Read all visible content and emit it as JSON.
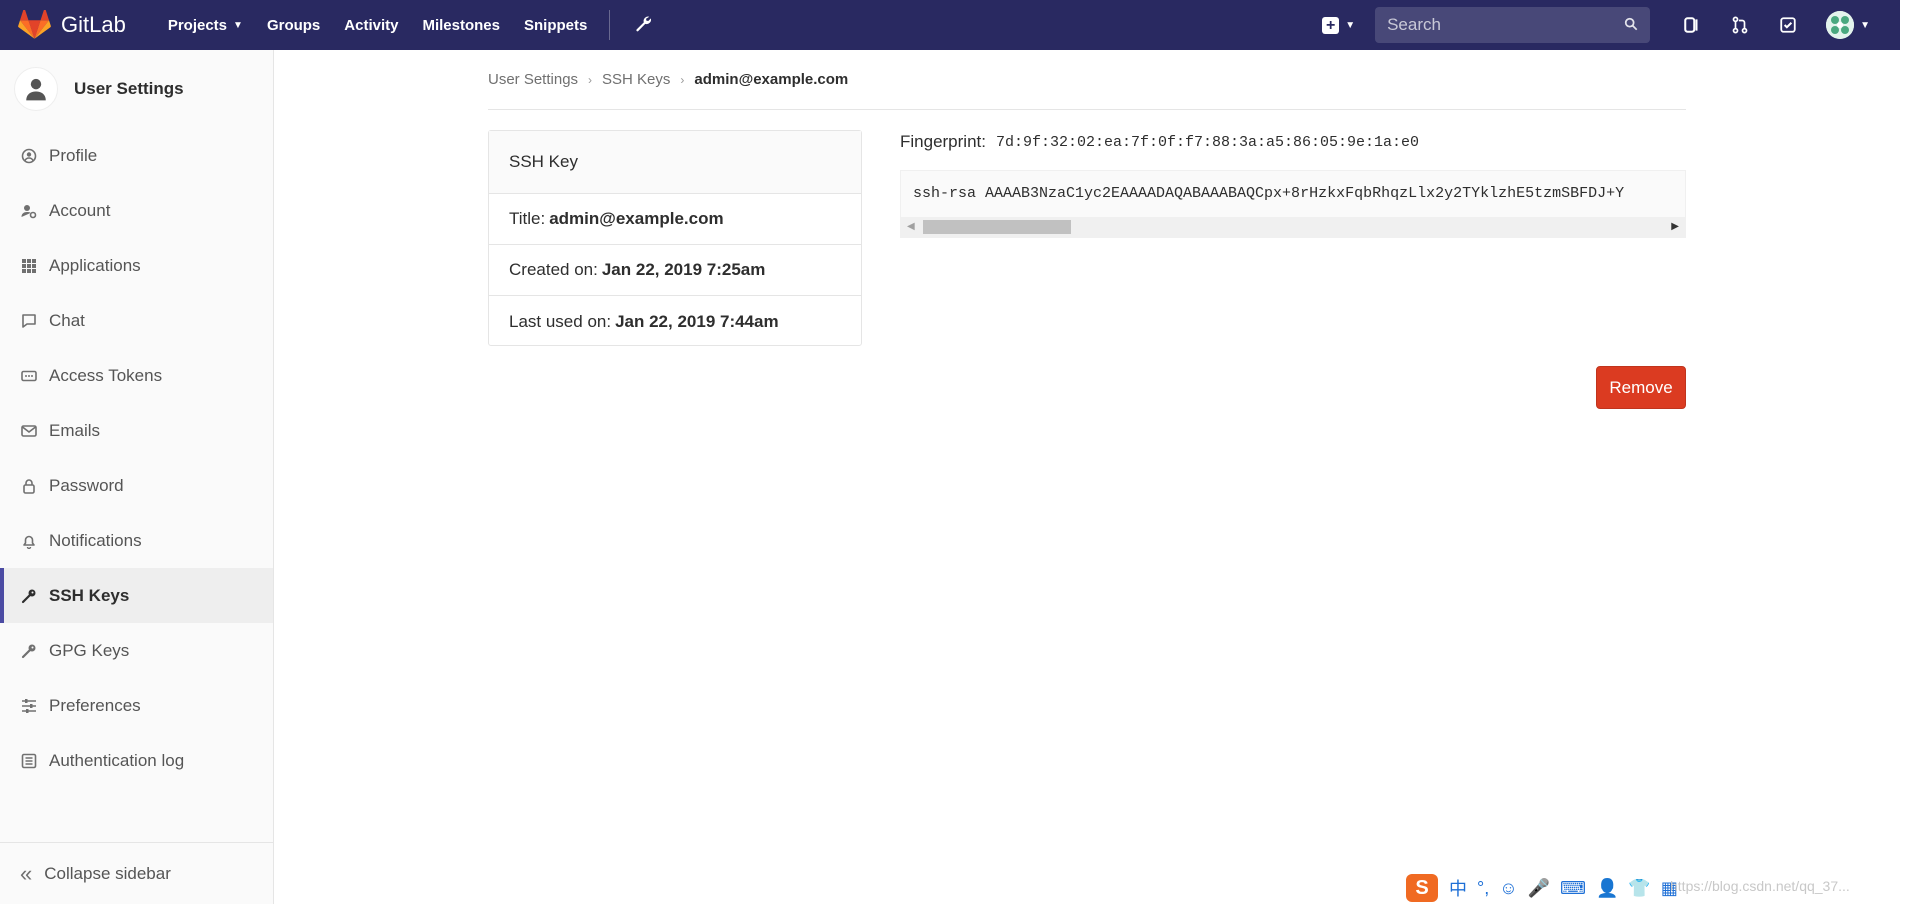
{
  "nav": {
    "brand": "GitLab",
    "links": [
      "Projects",
      "Groups",
      "Activity",
      "Milestones",
      "Snippets"
    ],
    "search_placeholder": "Search"
  },
  "sidebar": {
    "context_title": "User Settings",
    "items": [
      {
        "label": "Profile",
        "icon": "profile-icon"
      },
      {
        "label": "Account",
        "icon": "account-icon"
      },
      {
        "label": "Applications",
        "icon": "applications-icon"
      },
      {
        "label": "Chat",
        "icon": "chat-icon"
      },
      {
        "label": "Access Tokens",
        "icon": "access-tokens-icon"
      },
      {
        "label": "Emails",
        "icon": "email-icon"
      },
      {
        "label": "Password",
        "icon": "lock-icon"
      },
      {
        "label": "Notifications",
        "icon": "bell-icon"
      },
      {
        "label": "SSH Keys",
        "icon": "key-icon",
        "active": true
      },
      {
        "label": "GPG Keys",
        "icon": "key-icon"
      },
      {
        "label": "Preferences",
        "icon": "sliders-icon"
      },
      {
        "label": "Authentication log",
        "icon": "log-icon"
      }
    ],
    "collapse_label": "Collapse sidebar"
  },
  "breadcrumb": {
    "items": [
      "User Settings",
      "SSH Keys"
    ],
    "current": "admin@example.com"
  },
  "ssh_key": {
    "heading": "SSH Key",
    "title_label": "Title:",
    "title_value": "admin@example.com",
    "created_label": "Created on:",
    "created_value": "Jan 22, 2019 7:25am",
    "last_used_label": "Last used on:",
    "last_used_value": "Jan 22, 2019 7:44am",
    "fingerprint_label": "Fingerprint:",
    "fingerprint_value": "7d:9f:32:02:ea:7f:0f:f7:88:3a:a5:86:05:9e:1a:e0",
    "key_text": "ssh-rsa AAAAB3NzaC1yc2EAAAADAQABAAABAQCpx+8rHzkxFqbRhqzLlx2y2TYklzhE5tzmSBFDJ+Y",
    "remove_label": "Remove"
  },
  "ime": {
    "logo": "S",
    "glyphs": [
      "中",
      "°,",
      "☺",
      "🎤",
      "⌨",
      "👤",
      "👕",
      "▦"
    ]
  },
  "watermark": "https://blog.csdn.net/qq_37..."
}
